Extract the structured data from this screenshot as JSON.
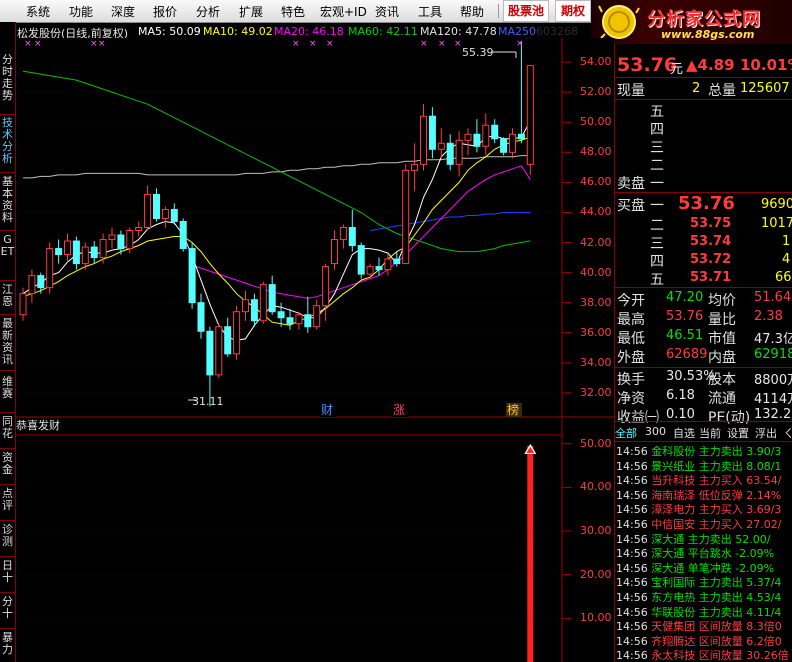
{
  "menu": {
    "items": [
      "系统",
      "功能",
      "深度",
      "报价",
      "分析",
      "扩展",
      "特色",
      "宏观+ID",
      "资讯",
      "工具",
      "帮助"
    ],
    "stock_pool": "股票池",
    "futures": "期权"
  },
  "logo": {
    "title": "分析家公式网",
    "url": "www.88gs.com"
  },
  "left_tabs": [
    "分时走势",
    "技术分析",
    "基本资料",
    "GET",
    "江恩",
    "最新资讯",
    "维赛",
    "同花",
    "资金",
    "点评",
    "诊测",
    "日十",
    "分十",
    "暴力"
  ],
  "header": {
    "title": "松发股份(日线,前复权)",
    "ma5": "MA5: 50.09",
    "ma10": "MA10: 49.02",
    "ma20": "MA20: 46.18",
    "ma60": "MA60: 42.11",
    "ma120": "MA120: 47.78",
    "ma250": "MA250",
    "code": "603268"
  },
  "price_axis": [
    "54.00",
    "52.00",
    "50.00",
    "48.00",
    "46.00",
    "44.00",
    "42.00",
    "40.00",
    "38.00",
    "36.00",
    "34.00",
    "32.00"
  ],
  "markers": {
    "high_label": "55.39",
    "low_label": "31.11",
    "cai": "财",
    "zhang": "涨",
    "bang": "榜"
  },
  "indicator": {
    "name": "恭喜发财",
    "axis": [
      "50.00",
      "40.00",
      "30.00",
      "20.00",
      "10.00"
    ]
  },
  "quote": {
    "price": "53.76",
    "unit": "元",
    "change": "▲4.89",
    "pct": "10.01%",
    "vol_label": "现量",
    "vol_now": "2",
    "total_label": "总量",
    "total": "125607",
    "sell_levels": [
      "五",
      "四",
      "三",
      "二",
      "一"
    ],
    "sell_label": "卖盘",
    "buy_label": "买盘",
    "bid1_level": "一",
    "bid1_price": "53.76",
    "bid1_vol": "9690",
    "bids": [
      {
        "level": "二",
        "price": "53.75",
        "vol": "1017"
      },
      {
        "level": "三",
        "price": "53.74",
        "vol": "1"
      },
      {
        "level": "四",
        "price": "53.72",
        "vol": "4"
      },
      {
        "level": "五",
        "price": "53.71",
        "vol": "66"
      }
    ],
    "stats": [
      {
        "l1": "今开",
        "v1": "47.20",
        "c1": "grn",
        "l2": "均价",
        "v2": "51.64",
        "c2": "red"
      },
      {
        "l1": "最高",
        "v1": "53.76",
        "c1": "red",
        "l2": "量比",
        "v2": "2.38",
        "c2": "red"
      },
      {
        "l1": "最低",
        "v1": "46.51",
        "c1": "grn",
        "l2": "市值",
        "v2": "47.3亿",
        "c2": "wht"
      },
      {
        "l1": "外盘",
        "v1": "62689",
        "c1": "red",
        "l2": "内盘",
        "v2": "62918",
        "c2": "grn"
      },
      {
        "l1": "换手",
        "v1": "30.53%",
        "c1": "wht",
        "l2": "股本",
        "v2": "8800万",
        "c2": "wht"
      },
      {
        "l1": "净资",
        "v1": "6.18",
        "c1": "wht",
        "l2": "流通",
        "v2": "4114万",
        "c2": "wht"
      },
      {
        "l1": "收益㈠",
        "v1": "0.10",
        "c1": "wht",
        "l2": "PE(动)",
        "v2": "132.2",
        "c2": "wht"
      }
    ]
  },
  "tape_tabs": [
    "全部",
    "300",
    "自选",
    "当前",
    "设置",
    "浮出",
    "ㄑ"
  ],
  "tape": [
    {
      "t": "14:56",
      "name": "金科股份",
      "type": "主力卖出",
      "val": "3.90/3",
      "c": "grn"
    },
    {
      "t": "14:56",
      "name": "景兴纸业",
      "type": "主力卖出",
      "val": "8.08/1",
      "c": "grn"
    },
    {
      "t": "14:56",
      "name": "当升科技",
      "type": "主力买入",
      "val": "63.54/",
      "c": "red"
    },
    {
      "t": "14:56",
      "name": "海南瑞泽",
      "type": "低位反弹",
      "val": "2.14%",
      "c": "red"
    },
    {
      "t": "14:56",
      "name": "漳泽电力",
      "type": "主力买入",
      "val": "3.69/3",
      "c": "red"
    },
    {
      "t": "14:56",
      "name": "中信国安",
      "type": "主力买入",
      "val": "27.02/",
      "c": "red"
    },
    {
      "t": "14:56",
      "name": "深大通",
      "type": "主力卖出",
      "val": "52.00/",
      "c": "grn"
    },
    {
      "t": "14:56",
      "name": "深大通",
      "type": "平台跳水",
      "val": "-2.09%",
      "c": "grn"
    },
    {
      "t": "14:56",
      "name": "深大通",
      "type": "单笔冲跌",
      "val": "-2.09%",
      "c": "grn"
    },
    {
      "t": "14:56",
      "name": "宝利国际",
      "type": "主力卖出",
      "val": "5.37/4",
      "c": "grn"
    },
    {
      "t": "14:56",
      "name": "东方电热",
      "type": "主力卖出",
      "val": "4.53/4",
      "c": "grn"
    },
    {
      "t": "14:56",
      "name": "华联股份",
      "type": "主力卖出",
      "val": "4.11/4",
      "c": "grn"
    },
    {
      "t": "14:56",
      "name": "天健集团",
      "type": "区间放量",
      "val": "8.3倍0",
      "c": "red"
    },
    {
      "t": "14:56",
      "name": "齐翔腾达",
      "type": "区间放量",
      "val": "6.2倍0",
      "c": "red"
    },
    {
      "t": "14:56",
      "name": "永太科技",
      "type": "区间放量",
      "val": "30.26倍",
      "c": "red"
    }
  ],
  "chart_data": {
    "type": "candlestick",
    "ylim": [
      30.4,
      55.6
    ],
    "candles": [
      [
        37.2,
        39.0,
        36.8,
        38.6
      ],
      [
        38.6,
        40.2,
        38.0,
        39.8
      ],
      [
        39.8,
        40.0,
        38.6,
        39.0
      ],
      [
        39.0,
        42.0,
        38.6,
        41.6
      ],
      [
        41.6,
        42.2,
        40.6,
        41.2
      ],
      [
        41.2,
        42.6,
        40.8,
        42.1
      ],
      [
        42.1,
        42.4,
        40.2,
        40.6
      ],
      [
        40.6,
        42.0,
        40.2,
        41.7
      ],
      [
        41.7,
        42.1,
        40.6,
        41.0
      ],
      [
        41.0,
        42.6,
        40.6,
        42.2
      ],
      [
        42.2,
        43.0,
        41.6,
        42.5
      ],
      [
        42.5,
        42.8,
        41.2,
        41.6
      ],
      [
        41.6,
        43.0,
        41.3,
        42.8
      ],
      [
        42.8,
        43.4,
        42.4,
        43.0
      ],
      [
        43.0,
        45.8,
        42.8,
        45.2
      ],
      [
        45.2,
        45.6,
        43.4,
        43.6
      ],
      [
        43.6,
        44.4,
        43.0,
        44.2
      ],
      [
        44.2,
        44.6,
        43.2,
        43.4
      ],
      [
        43.4,
        43.6,
        41.4,
        41.6
      ],
      [
        41.6,
        42.0,
        37.6,
        38.0
      ],
      [
        38.0,
        38.6,
        35.6,
        36.1
      ],
      [
        36.1,
        36.4,
        31.1,
        33.2
      ],
      [
        33.2,
        36.6,
        33.0,
        36.4
      ],
      [
        36.4,
        37.0,
        34.4,
        34.6
      ],
      [
        34.6,
        37.8,
        34.2,
        37.4
      ],
      [
        37.4,
        38.8,
        36.8,
        38.2
      ],
      [
        38.2,
        38.6,
        36.4,
        36.8
      ],
      [
        36.8,
        39.4,
        36.6,
        39.2
      ],
      [
        39.2,
        39.8,
        37.2,
        37.4
      ],
      [
        37.4,
        38.0,
        36.4,
        37.0
      ],
      [
        37.0,
        37.6,
        36.2,
        36.6
      ],
      [
        36.6,
        37.4,
        36.2,
        37.2
      ],
      [
        37.2,
        38.4,
        36.0,
        36.4
      ],
      [
        36.4,
        38.2,
        36.2,
        37.8
      ],
      [
        37.8,
        40.6,
        36.8,
        40.4
      ],
      [
        40.6,
        42.8,
        40.2,
        42.2
      ],
      [
        42.2,
        43.2,
        41.6,
        43.0
      ],
      [
        43.0,
        44.2,
        41.4,
        41.8
      ],
      [
        41.8,
        42.0,
        39.6,
        39.9
      ],
      [
        39.9,
        40.6,
        39.6,
        40.4
      ],
      [
        40.4,
        41.0,
        39.8,
        40.2
      ],
      [
        40.2,
        41.2,
        39.8,
        40.9
      ],
      [
        40.9,
        41.4,
        40.4,
        40.6
      ],
      [
        40.6,
        47.2,
        40.6,
        46.8
      ],
      [
        46.8,
        48.6,
        45.4,
        47.2
      ],
      [
        47.2,
        51.2,
        46.8,
        50.4
      ],
      [
        50.4,
        51.0,
        47.6,
        48.2
      ],
      [
        48.2,
        49.6,
        47.6,
        48.6
      ],
      [
        48.6,
        49.2,
        46.8,
        47.2
      ],
      [
        47.2,
        49.4,
        46.4,
        48.8
      ],
      [
        48.8,
        49.6,
        47.8,
        49.2
      ],
      [
        49.2,
        50.2,
        48.0,
        48.4
      ],
      [
        48.4,
        50.6,
        47.8,
        49.8
      ],
      [
        49.8,
        50.2,
        48.6,
        48.9
      ],
      [
        48.9,
        49.0,
        47.8,
        48.0
      ],
      [
        48.0,
        49.6,
        47.6,
        49.2
      ],
      [
        49.2,
        55.39,
        48.6,
        48.89
      ],
      [
        47.2,
        53.76,
        46.51,
        53.76
      ]
    ],
    "ma5": [
      38.6,
      39.0,
      39.3,
      39.8,
      40.0,
      40.7,
      41.2,
      41.4,
      41.3,
      41.3,
      41.5,
      41.6,
      41.8,
      42.2,
      42.9,
      43.2,
      43.4,
      43.3,
      42.5,
      41.1,
      39.5,
      37.9,
      36.5,
      35.7,
      35.5,
      35.6,
      36.5,
      37.2,
      37.8,
      37.7,
      37.5,
      37.3,
      37.0,
      37.0,
      37.7,
      38.6,
      39.9,
      41.2,
      41.6,
      41.6,
      41.5,
      41.3,
      40.6,
      42.0,
      43.2,
      45.0,
      46.2,
      47.7,
      48.3,
      48.6,
      48.5,
      48.4,
      49.0,
      49.1,
      48.9,
      48.9,
      49.0,
      50.09
    ],
    "ma10": [
      38.4,
      38.6,
      38.8,
      39.1,
      39.4,
      39.8,
      40.1,
      40.4,
      40.6,
      40.9,
      41.1,
      41.4,
      41.6,
      41.8,
      42.1,
      42.2,
      42.3,
      42.4,
      42.4,
      42.0,
      41.4,
      40.6,
      39.9,
      39.3,
      38.6,
      38.1,
      37.7,
      37.2,
      36.7,
      36.6,
      36.5,
      36.8,
      37.0,
      37.3,
      37.6,
      38.1,
      38.6,
      39.0,
      39.5,
      39.7,
      40.2,
      40.9,
      41.4,
      41.7,
      42.5,
      43.3,
      44.2,
      44.8,
      45.4,
      46.0,
      46.8,
      47.3,
      47.7,
      48.2,
      48.5,
      48.7,
      48.8,
      49.02
    ],
    "ma20": [
      null,
      null,
      null,
      null,
      null,
      null,
      null,
      null,
      null,
      null,
      null,
      null,
      null,
      null,
      null,
      null,
      null,
      null,
      null,
      40.5,
      40.3,
      40.1,
      39.9,
      39.7,
      39.5,
      39.3,
      39.1,
      38.9,
      38.7,
      38.6,
      38.5,
      38.4,
      38.3,
      38.4,
      38.6,
      38.8,
      39.0,
      39.2,
      39.4,
      39.6,
      39.8,
      40.2,
      40.7,
      41.2,
      41.8,
      42.4,
      43.0,
      43.6,
      44.2,
      44.8,
      45.4,
      45.8,
      46.2,
      46.5,
      46.7,
      46.9,
      47.1,
      46.18
    ],
    "ma60": [
      53.4,
      53.3,
      53.2,
      53.1,
      53.0,
      52.9,
      52.8,
      52.6,
      52.4,
      52.2,
      52.0,
      51.8,
      51.6,
      51.4,
      51.2,
      50.9,
      50.6,
      50.3,
      50.0,
      49.7,
      49.4,
      49.1,
      48.8,
      48.5,
      48.2,
      47.9,
      47.6,
      47.3,
      47.0,
      46.7,
      46.4,
      46.1,
      45.8,
      45.5,
      45.2,
      44.9,
      44.6,
      44.3,
      44.0,
      43.6,
      43.2,
      42.9,
      42.6,
      42.4,
      42.2,
      42.0,
      41.8,
      41.6,
      41.5,
      41.4,
      41.4,
      41.4,
      41.5,
      41.6,
      41.8,
      41.9,
      42.0,
      42.11
    ],
    "ma120": [
      46.3,
      46.3,
      46.4,
      46.4,
      46.5,
      46.5,
      46.5,
      46.6,
      46.6,
      46.6,
      46.6,
      46.6,
      46.6,
      46.6,
      46.5,
      46.5,
      46.5,
      46.5,
      46.5,
      46.5,
      46.5,
      46.5,
      46.5,
      46.5,
      46.5,
      46.6,
      46.6,
      46.6,
      46.7,
      46.7,
      46.8,
      46.8,
      46.9,
      46.9,
      47.0,
      47.0,
      47.1,
      47.1,
      47.2,
      47.2,
      47.3,
      47.3,
      47.3,
      47.4,
      47.4,
      47.5,
      47.5,
      47.5,
      47.6,
      47.6,
      47.6,
      47.6,
      47.7,
      47.7,
      47.7,
      47.7,
      47.78,
      47.78
    ],
    "ma250": [
      null,
      null,
      null,
      null,
      null,
      null,
      null,
      null,
      null,
      null,
      null,
      null,
      null,
      null,
      null,
      null,
      null,
      null,
      null,
      null,
      null,
      null,
      null,
      null,
      null,
      null,
      null,
      null,
      null,
      null,
      null,
      null,
      null,
      null,
      null,
      null,
      null,
      null,
      null,
      42.8,
      42.9,
      43.0,
      43.1,
      43.2,
      43.3,
      43.4,
      43.5,
      43.6,
      43.7,
      43.7,
      43.8,
      43.8,
      43.9,
      43.9,
      44.0,
      44.0,
      44.0,
      44.0
    ],
    "indicator": {
      "ylim": [
        0,
        52
      ],
      "bar_value": 49.5,
      "bar_index": 57
    }
  },
  "colors": {
    "up": "#ff3c3c",
    "down": "#54ffff",
    "ma5": "#ffffff",
    "ma10": "#ffff00",
    "ma20": "#ff00ff",
    "ma60": "#00c000",
    "ma120": "#c0c0c0",
    "ma250": "#2040ff"
  }
}
